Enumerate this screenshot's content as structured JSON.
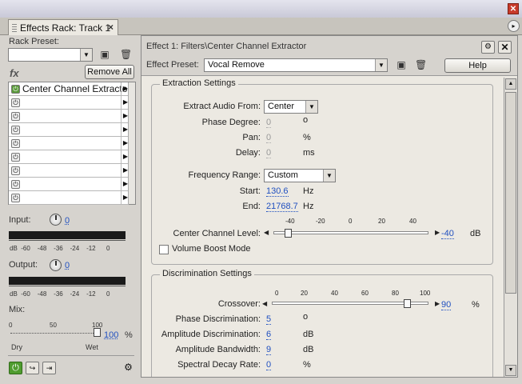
{
  "window": {
    "close_label": "✕"
  },
  "tab": {
    "title": "Effects Rack: Track 1",
    "close": "×",
    "menu": "▸"
  },
  "rack": {
    "preset_label": "Rack Preset:",
    "preset_value": "",
    "remove_all": "Remove All",
    "slots": [
      {
        "name": "Center Channel Extractor",
        "on": true
      },
      {
        "name": "",
        "on": false
      },
      {
        "name": "",
        "on": false
      },
      {
        "name": "",
        "on": false
      },
      {
        "name": "",
        "on": false
      },
      {
        "name": "",
        "on": false
      },
      {
        "name": "",
        "on": false
      },
      {
        "name": "",
        "on": false
      },
      {
        "name": "",
        "on": false
      }
    ]
  },
  "input": {
    "label": "Input:",
    "value": "0"
  },
  "output": {
    "label": "Output:",
    "value": "0"
  },
  "meter_scale": [
    "dB",
    "-60",
    "-48",
    "-36",
    "-24",
    "-12",
    "0"
  ],
  "mix": {
    "label": "Mix:",
    "ticks": [
      "0",
      "50",
      "100"
    ],
    "value": "100",
    "unit": "%",
    "dry": "Dry",
    "wet": "Wet",
    "level_percent": 100
  },
  "effect": {
    "heading": "Effect 1: Filters\\Center Channel Extractor",
    "preset_label": "Effect Preset:",
    "preset_value": "Vocal Remove",
    "help": "Help"
  },
  "extraction": {
    "title": "Extraction Settings",
    "extract_label": "Extract Audio From:",
    "extract_value": "Center",
    "phase_label": "Phase Degree:",
    "phase_value": "0",
    "phase_unit": "o",
    "pan_label": "Pan:",
    "pan_value": "0",
    "pan_unit": "%",
    "delay_label": "Delay:",
    "delay_value": "0",
    "delay_unit": "ms",
    "freq_label": "Frequency Range:",
    "freq_value": "Custom",
    "start_label": "Start:",
    "start_value": "130.6",
    "start_unit": "Hz",
    "end_label": "End:",
    "end_value": "21768.7",
    "end_unit": "Hz",
    "ccl_label": "Center Channel Level:",
    "ccl_ticks": [
      "-40",
      "-20",
      "0",
      "20",
      "40"
    ],
    "ccl_value": "-40",
    "ccl_unit": "dB",
    "ccl_level": -40,
    "volume_boost": "Volume Boost Mode"
  },
  "discrimination": {
    "title": "Discrimination Settings",
    "crossover_label": "Crossover:",
    "crossover_ticks": [
      "0",
      "20",
      "40",
      "60",
      "80",
      "100"
    ],
    "crossover_value": "90",
    "crossover_unit": "%",
    "crossover_level": 90,
    "phase_label": "Phase Discrimination:",
    "phase_value": "5",
    "phase_unit": "o",
    "amp_label": "Amplitude Discrimination:",
    "amp_value": "6",
    "amp_unit": "dB",
    "bw_label": "Amplitude Bandwidth:",
    "bw_value": "9",
    "bw_unit": "dB",
    "spectral_label": "Spectral Decay Rate:",
    "spectral_value": "0",
    "spectral_unit": "%"
  }
}
